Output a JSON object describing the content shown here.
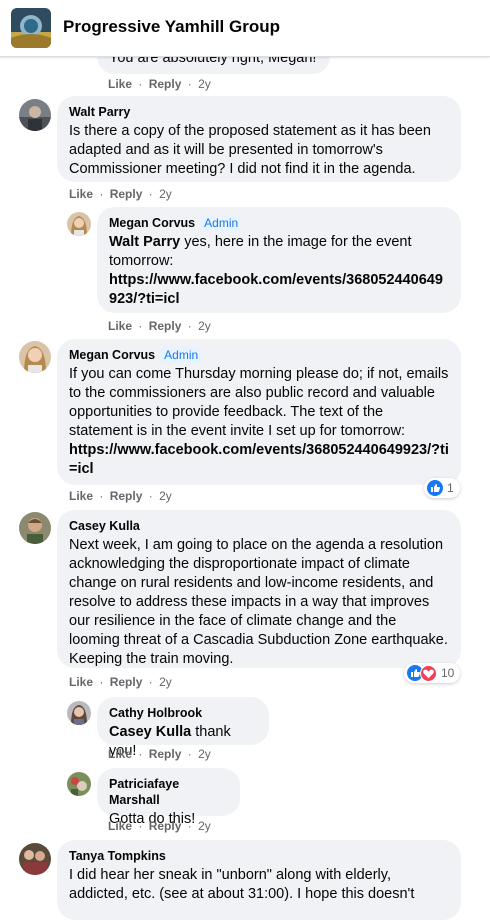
{
  "group": {
    "title": "Progressive Yamhill Group"
  },
  "actions": {
    "like": "Like",
    "reply": "Reply",
    "sep": "·"
  },
  "comments": [
    {
      "author": "",
      "text": "You are absolutely right, Megan!",
      "time": "2y"
    },
    {
      "author": "Walt Parry",
      "text": "Is there a copy of the proposed statement as it has been adapted and as it will be presented in tomorrow's Commissioner meeting? I did not find it in the agenda.",
      "time": "2y"
    },
    {
      "author": "Megan Corvus",
      "badge": "Admin",
      "mention": "Walt Parry",
      "text": " yes, here in the image for the event tomorrow:",
      "link": "https://www.facebook.com/events/368052440649923/?ti=icl",
      "time": "2y"
    },
    {
      "author": "Megan Corvus",
      "badge": "Admin",
      "text": "If you can come Thursday morning please do; if not, emails to the commissioners are also public record and valuable opportunities to provide feedback. The text of the statement is in the event invite I set up for tomorrow:",
      "link": "https://www.facebook.com/events/368052440649923/?ti=icl",
      "time": "2y",
      "reaction_count": "1"
    },
    {
      "author": "Casey Kulla",
      "text": "Next week, I am going to place on the agenda a resolution acknowledging the disproportionate impact of climate change on rural residents and low-income residents, and resolve to address these impacts in a way that improves our resilience in the face of climate change and the looming threat of a Cascadia Subduction Zone earthquake. Keeping the train moving.",
      "time": "2y",
      "reaction_count": "10"
    },
    {
      "author": "Cathy Holbrook",
      "mention": "Casey Kulla",
      "text": " thank you!",
      "time": "2y"
    },
    {
      "author": "Patriciafaye Marshall",
      "text": "Gotta do this!",
      "time": "2y"
    },
    {
      "author": "Tanya Tompkins",
      "text": "I did hear her sneak in \"unborn\" along with elderly, addicted, etc. (see at about 31:00). I hope this doesn't"
    }
  ],
  "colors": {
    "like_blue": "#1877f2",
    "love_red": "#f33e58",
    "bubble_bg": "#f0f2f5",
    "meta_gray": "#65676b"
  },
  "icons": [
    "group-logo",
    "like-reaction-icon",
    "love-reaction-icon"
  ]
}
